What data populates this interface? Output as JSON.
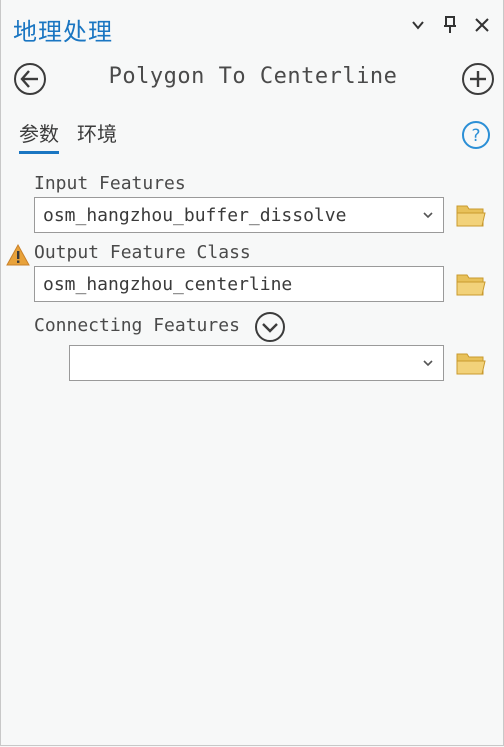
{
  "pane": {
    "title": "地理处理",
    "controls": {
      "dropdown_icon": "chevron-down-icon",
      "pin_icon": "pin-icon",
      "close_icon": "close-icon"
    }
  },
  "tool": {
    "title": "Polygon To Centerline",
    "back_icon": "back-arrow-icon",
    "add_icon": "add-circle-icon"
  },
  "tabs": [
    {
      "label": "参数",
      "active": true
    },
    {
      "label": "环境",
      "active": false
    }
  ],
  "help_icon": "help-icon",
  "params": {
    "input_features": {
      "label": "Input Features",
      "value": "osm_hangzhou_buffer_dissolve"
    },
    "output_feature_class": {
      "label": "Output Feature Class",
      "value": "osm_hangzhou_centerline",
      "warning_icon": "warning-icon"
    },
    "connecting_features": {
      "label": "Connecting Features",
      "value": ""
    }
  },
  "colors": {
    "accent": "#1a76c2",
    "folder": "#e8c15a",
    "warning": "#e8a23a"
  }
}
